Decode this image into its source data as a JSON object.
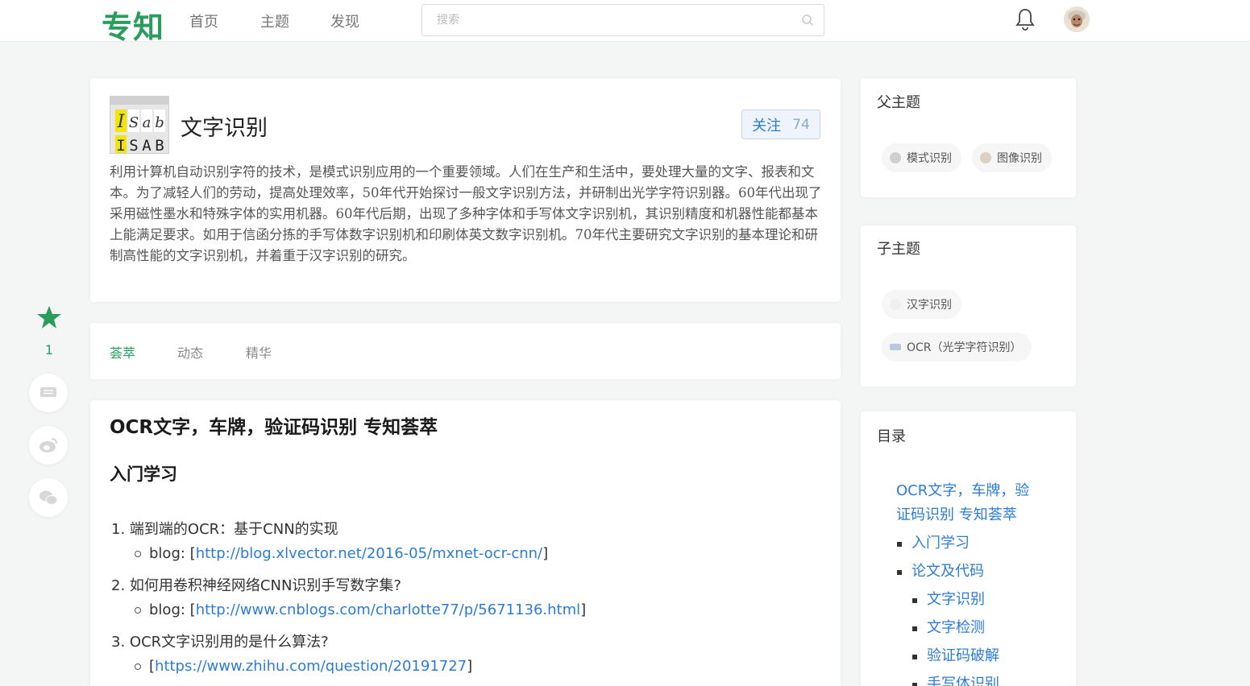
{
  "header": {
    "logo": "专知",
    "nav": [
      "首页",
      "主题",
      "发现"
    ],
    "search_placeholder": "搜索"
  },
  "topic": {
    "image_text_top": [
      "I",
      "S",
      "a",
      "b"
    ],
    "image_text_bottom": [
      "I",
      "S",
      "A",
      "B"
    ],
    "title": "文字识别",
    "follow_label": "关注",
    "follow_count": "74",
    "description": "利用计算机自动识别字符的技术，是模式识别应用的一个重要领域。人们在生产和生活中，要处理大量的文字、报表和文本。为了减轻人们的劳动，提高处理效率，50年代开始探讨一般文字识别方法，并研制出光学字符识别器。60年代出现了采用磁性墨水和特殊字体的实用机器。60年代后期，出现了多种字体和手写体文字识别机，其识别精度和机器性能都基本上能满足要求。如用于信函分拣的手写体数字识别机和印刷体英文数字识别机。70年代主要研究文字识别的基本理论和研制高性能的文字识别机，并着重于汉字识别的研究。"
  },
  "tabs": [
    "荟萃",
    "动态",
    "精华"
  ],
  "article": {
    "h1": "OCR文字，车牌，验证码识别 专知荟萃",
    "h2": "入门学习",
    "items": [
      {
        "num": "1.",
        "text": "端到端的OCR：基于CNN的实现",
        "sub_prefix": "blog: [",
        "sub_link": "http://blog.xlvector.net/2016-05/mxnet-ocr-cnn/",
        "sub_suffix": "]"
      },
      {
        "num": "2.",
        "text": "如何用卷积神经网络CNN识别手写数字集?",
        "sub_prefix": "blog: [",
        "sub_link": "http://www.cnblogs.com/charlotte77/p/5671136.html",
        "sub_suffix": "]"
      },
      {
        "num": "3.",
        "text": "OCR文字识别用的是什么算法?",
        "sub_prefix": "[",
        "sub_link": "https://www.zhihu.com/question/20191727",
        "sub_suffix": "]"
      }
    ]
  },
  "sidebar": {
    "parent_title": "父主题",
    "parents": [
      "模式识别",
      "图像识别"
    ],
    "child_title": "子主题",
    "children": [
      "汉字识别",
      "OCR（光学字符识别）"
    ],
    "toc_title": "目录",
    "toc": [
      "OCR文字，车牌，验",
      "证码识别 专知荟萃",
      "入门学习",
      "论文及代码",
      "文字识别",
      "文字检测",
      "验证码破解",
      "手写体识别"
    ]
  },
  "float_bar": {
    "star_count": "1"
  },
  "colors": {
    "brand_green": "#2a9d5e",
    "link_blue": "#2b7bd9"
  }
}
